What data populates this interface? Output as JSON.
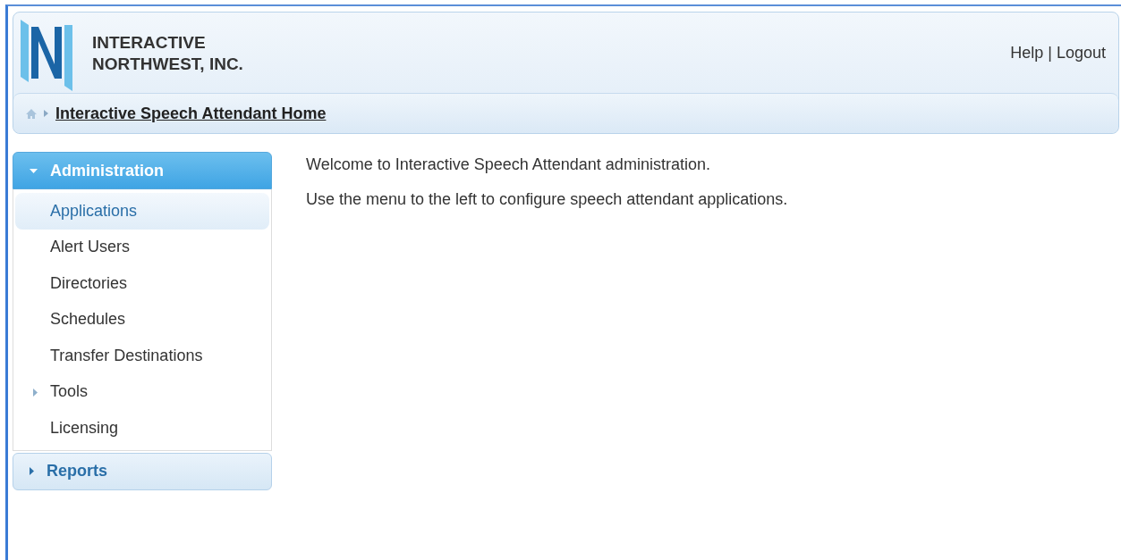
{
  "header": {
    "logo_lines": [
      "INTERACTIVE",
      "NORTHWEST, INC."
    ],
    "links": [
      {
        "label": "Help"
      },
      {
        "label": "Logout"
      }
    ],
    "separator": "|"
  },
  "breadcrumb": {
    "items": [
      "Interactive Speech Attendant Home"
    ]
  },
  "sidebar": {
    "sections": [
      {
        "label": "Administration",
        "expanded": true,
        "items": [
          {
            "label": "Applications",
            "selected": true,
            "kind": "link"
          },
          {
            "label": "Alert Users",
            "selected": false,
            "kind": "link"
          },
          {
            "label": "Directories",
            "selected": false,
            "kind": "link"
          },
          {
            "label": "Schedules",
            "selected": false,
            "kind": "link"
          },
          {
            "label": "Transfer Destinations",
            "selected": false,
            "kind": "link"
          },
          {
            "label": "Tools",
            "selected": false,
            "kind": "group"
          },
          {
            "label": "Licensing",
            "selected": false,
            "kind": "link"
          }
        ]
      },
      {
        "label": "Reports",
        "expanded": false
      }
    ]
  },
  "content": {
    "paragraphs": [
      "Welcome to Interactive Speech Attendant administration.",
      "Use the menu to the left to configure speech attendant applications."
    ]
  }
}
